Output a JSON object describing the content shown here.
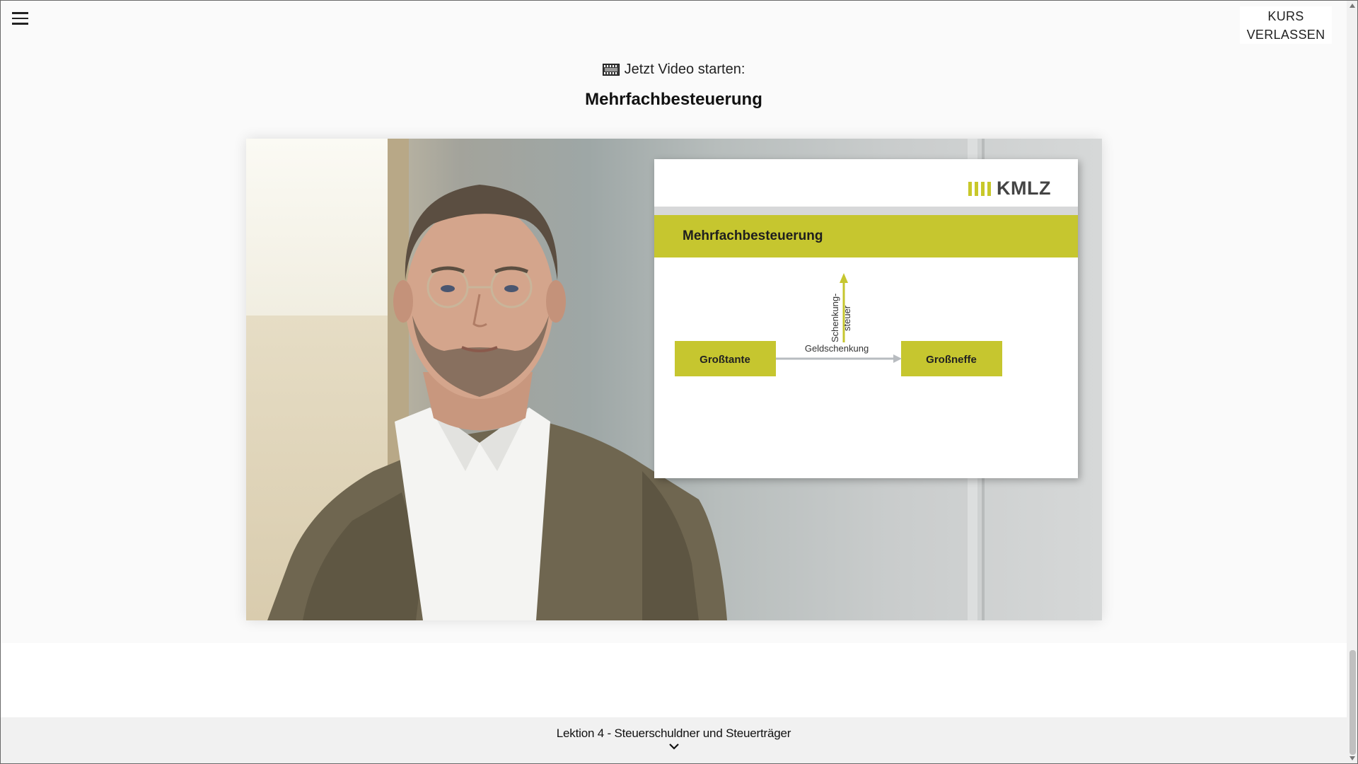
{
  "header": {
    "menu_icon": "hamburger-menu-icon",
    "exit_button_label": "KURS\nVERLASSEN"
  },
  "video": {
    "prompt_icon": "film-strip-icon",
    "prompt": "Jetzt Video starten:",
    "title": "Mehrfachbesteuerung"
  },
  "slide": {
    "logo_text": "KMLZ",
    "title": "Mehrfachbesteuerung",
    "diagram": {
      "left_box": "Großtante",
      "right_box": "Großneffe",
      "arrow_label": "Geldschenkung",
      "tax_label_line1": "Schenkung-",
      "tax_label_line2": "steuer"
    }
  },
  "footer": {
    "lesson_title": "Lektion 4 - Steuerschuldner und Steuerträger",
    "expand_icon": "chevron-down-icon"
  },
  "colors": {
    "accent": "#c6c62f",
    "slide_bar": "#d7d8d9",
    "footer_bg": "#f1f1f1"
  }
}
